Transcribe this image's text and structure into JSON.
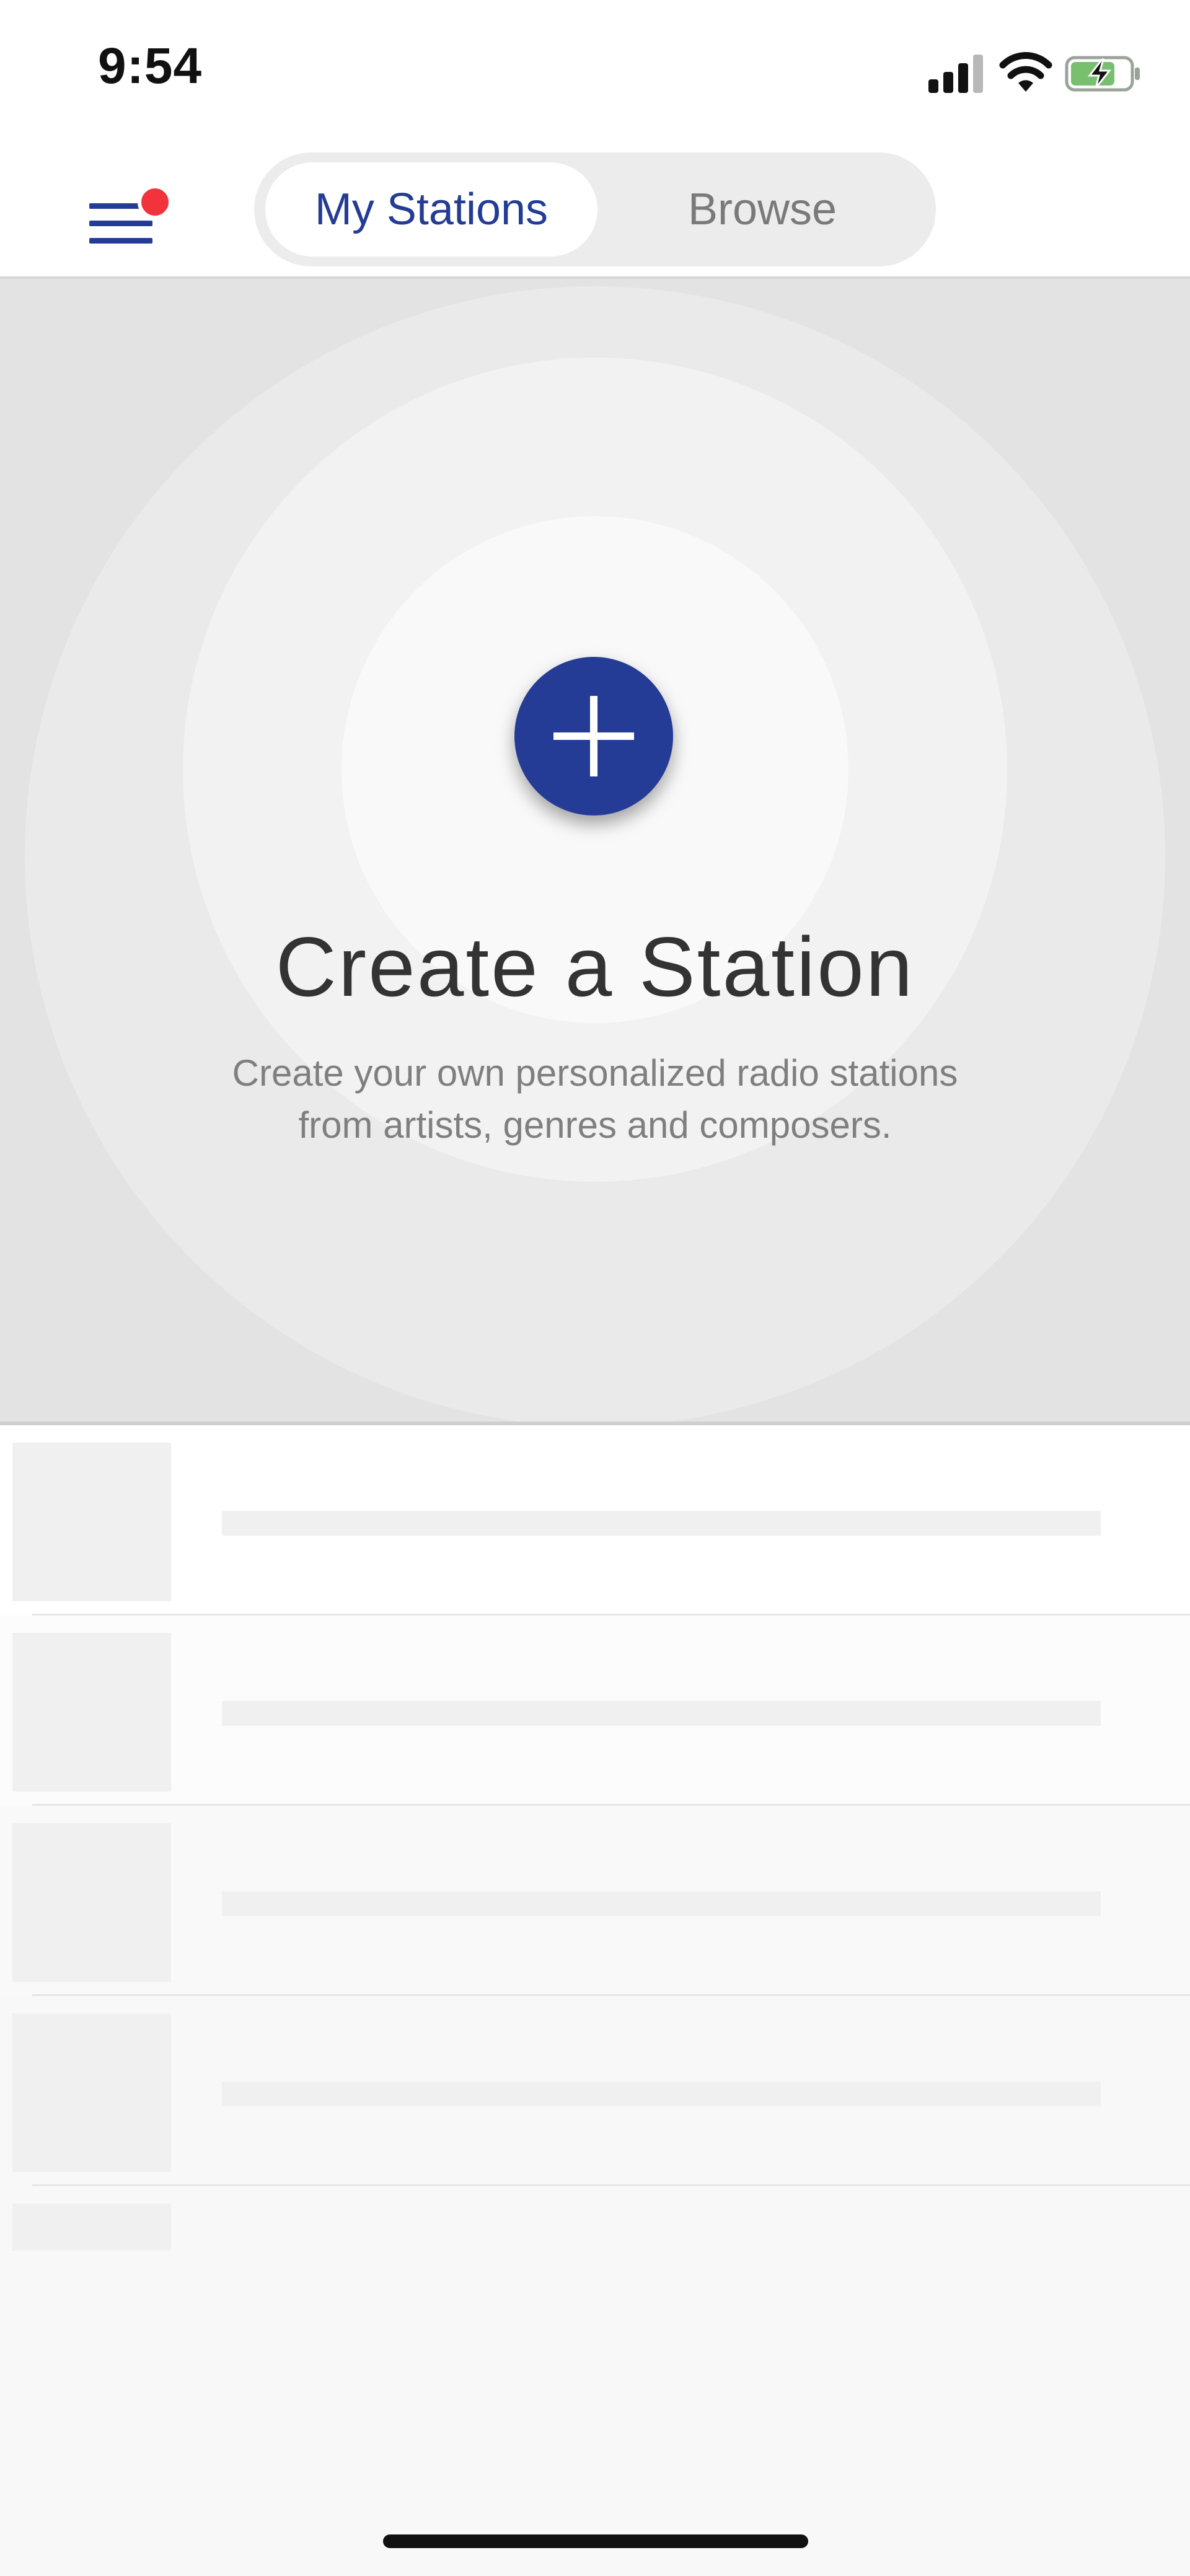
{
  "status_bar": {
    "time": "9:54",
    "signal_icon": "cellular-signal-icon",
    "wifi_icon": "wifi-icon",
    "battery_icon": "battery-charging-icon"
  },
  "nav": {
    "menu_icon": "hamburger-menu-icon",
    "notification_dot_color": "#f2333b",
    "tabs": [
      {
        "label": "My Stations",
        "active": true
      },
      {
        "label": "Browse",
        "active": false
      }
    ]
  },
  "hero": {
    "add_icon": "plus-icon",
    "title": "Create a Station",
    "description_line1": "Create your own personalized radio stations",
    "description_line2": "from artists, genres and composers."
  },
  "colors": {
    "accent": "#243c96",
    "inactive_text": "#7a7a7a",
    "placeholder": "#f0f0f0"
  }
}
